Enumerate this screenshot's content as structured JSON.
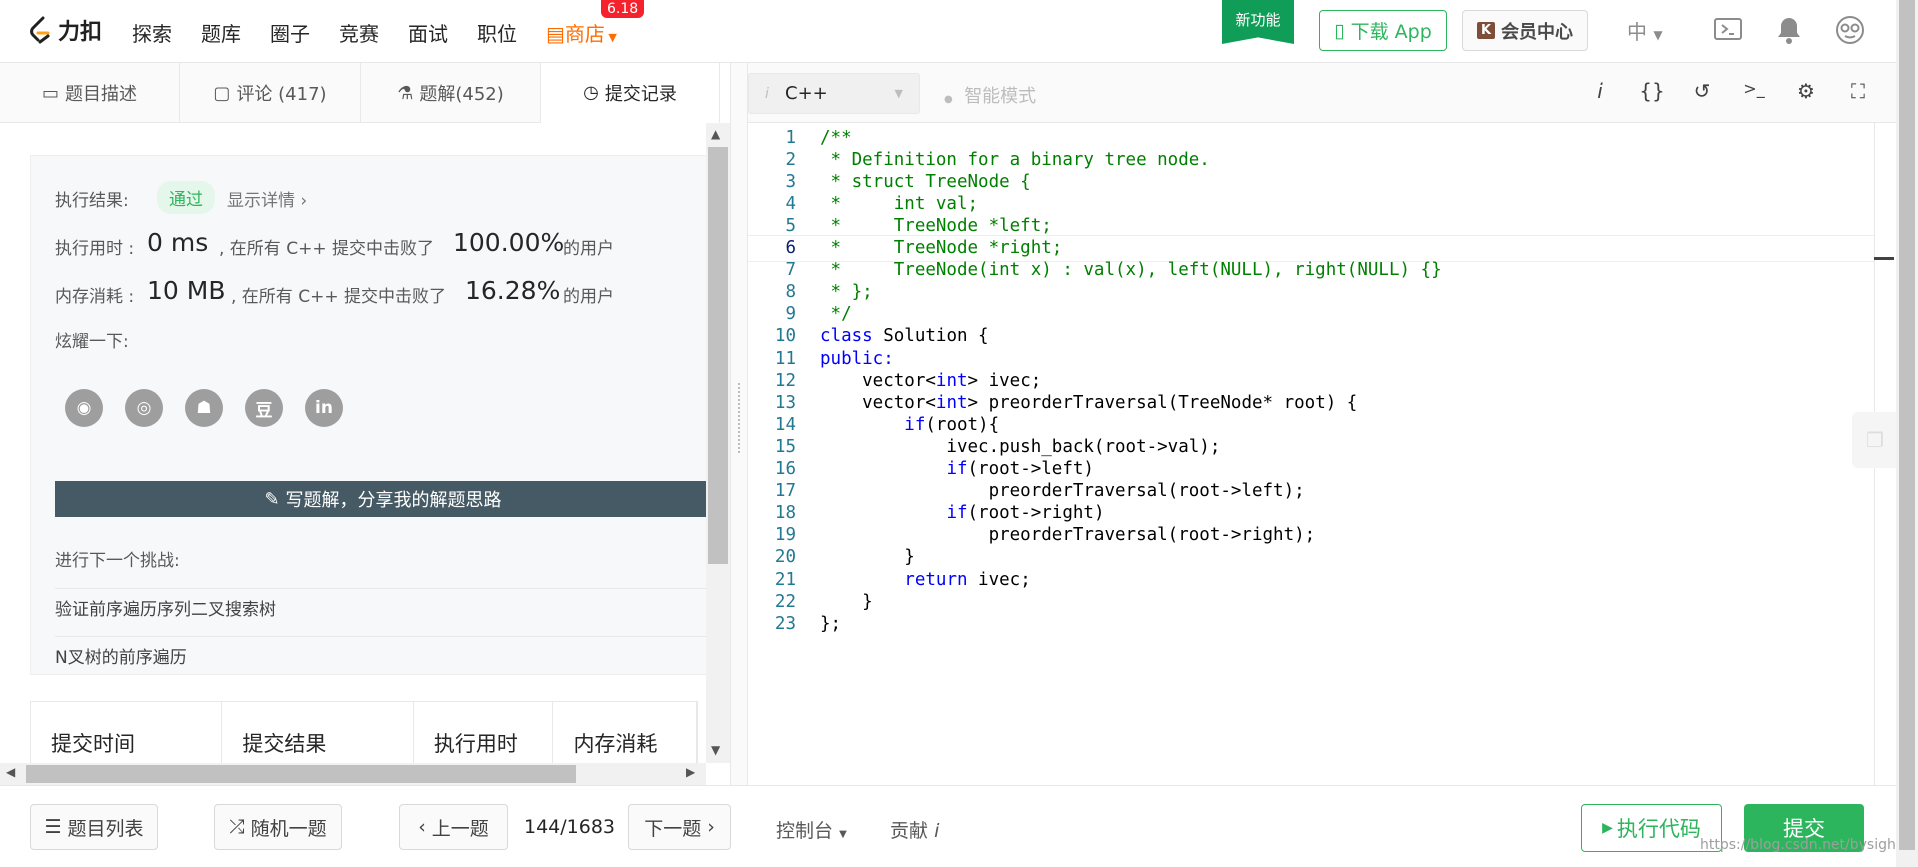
{
  "nav": {
    "logo_text": "力扣",
    "items": [
      "探索",
      "题库",
      "圈子",
      "竞赛",
      "面试",
      "职位"
    ],
    "store": "商店",
    "store_badge": "6.18",
    "new_feature": "新功能",
    "download_app": "下载 App",
    "vip": "会员中心",
    "lang": "中"
  },
  "tabs": [
    {
      "label": "题目描述",
      "icon": "description-icon"
    },
    {
      "label": "评论 (417)",
      "icon": "comment-icon"
    },
    {
      "label": "题解(452)",
      "icon": "flask-icon"
    },
    {
      "label": "提交记录",
      "icon": "clock-icon"
    }
  ],
  "result": {
    "label": "执行结果:",
    "status": "通过",
    "details": "显示详情 ›",
    "time_label": "执行用时 :",
    "time_value": "0 ms",
    "time_text": ", 在所有 C++ 提交中击败了",
    "time_pct": "100.00%",
    "time_suffix": "的用户",
    "mem_label": "内存消耗 :",
    "mem_value": "10 MB",
    "mem_text": ", 在所有 C++ 提交中击败了",
    "mem_pct": "16.28%",
    "mem_suffix": "的用户",
    "share_label": "炫耀一下:",
    "share_icons": [
      "wechat-icon",
      "weibo-icon",
      "qq-icon",
      "douban-icon",
      "linkedin-icon"
    ],
    "douban_glyph": "豆",
    "linkedin_glyph": "in",
    "write_solution": "写题解，分享我的解题思路",
    "next_label": "进行下一个挑战:",
    "next_items": [
      "验证前序遍历序列二叉搜索树",
      "N叉树的前序遍历"
    ]
  },
  "submissions_table": {
    "columns": [
      "提交时间",
      "提交结果",
      "执行用时",
      "内存消耗"
    ]
  },
  "editor_toolbar": {
    "language": "C++",
    "smart_mode": "智能模式",
    "info_glyph": "i",
    "braces_glyph": "{}",
    "terminal_glyph": ">_"
  },
  "code": [
    {
      "n": "1",
      "t": "/**",
      "c": "com"
    },
    {
      "n": "2",
      "t": " * Definition for a binary tree node.",
      "c": "com"
    },
    {
      "n": "3",
      "t": " * struct TreeNode {",
      "c": "com"
    },
    {
      "n": "4",
      "t": " *     int val;",
      "c": "com"
    },
    {
      "n": "5",
      "t": " *     TreeNode *left;",
      "c": "com"
    },
    {
      "n": "6",
      "t": " *     TreeNode *right;",
      "c": "com"
    },
    {
      "n": "7",
      "t": " *     TreeNode(int x) : val(x), left(NULL), right(NULL) {}",
      "c": "com"
    },
    {
      "n": "8",
      "t": " * };",
      "c": "com"
    },
    {
      "n": "9",
      "t": " */",
      "c": "com"
    },
    {
      "n": "10",
      "t": "class Solution {",
      "c": "mix1"
    },
    {
      "n": "11",
      "t": "public:",
      "c": "kw"
    },
    {
      "n": "12",
      "t": "    vector<int> ivec;",
      "c": "mix2"
    },
    {
      "n": "13",
      "t": "    vector<int> preorderTraversal(TreeNode* root) {",
      "c": "mix2"
    },
    {
      "n": "14",
      "t": "        if(root){",
      "c": "mix3"
    },
    {
      "n": "15",
      "t": "            ivec.push_back(root->val);",
      "c": "plain"
    },
    {
      "n": "16",
      "t": "            if(root->left)",
      "c": "mix3"
    },
    {
      "n": "17",
      "t": "                preorderTraversal(root->left);",
      "c": "plain"
    },
    {
      "n": "18",
      "t": "            if(root->right)",
      "c": "mix3"
    },
    {
      "n": "19",
      "t": "                preorderTraversal(root->right);",
      "c": "plain"
    },
    {
      "n": "20",
      "t": "        }",
      "c": "plain"
    },
    {
      "n": "21",
      "t": "        return ivec;",
      "c": "mix4"
    },
    {
      "n": "22",
      "t": "    }",
      "c": "plain"
    },
    {
      "n": "23",
      "t": "};",
      "c": "plain"
    }
  ],
  "bottom": {
    "problem_list": "题目列表",
    "random": "随机一题",
    "prev": "上一题",
    "page": "144/1683",
    "next": "下一题",
    "console": "控制台",
    "contribute": "贡献",
    "contribute_info": "i",
    "run": "执行代码",
    "submit": "提交",
    "watermark": "https://blog.csdn.net/bysigh..."
  },
  "colors": {
    "accent": "#2db55d",
    "store": "#ff6d00",
    "badge": "#f5222d",
    "comment": "#008000",
    "keyword": "#0000ff",
    "line_number": "#237893"
  }
}
